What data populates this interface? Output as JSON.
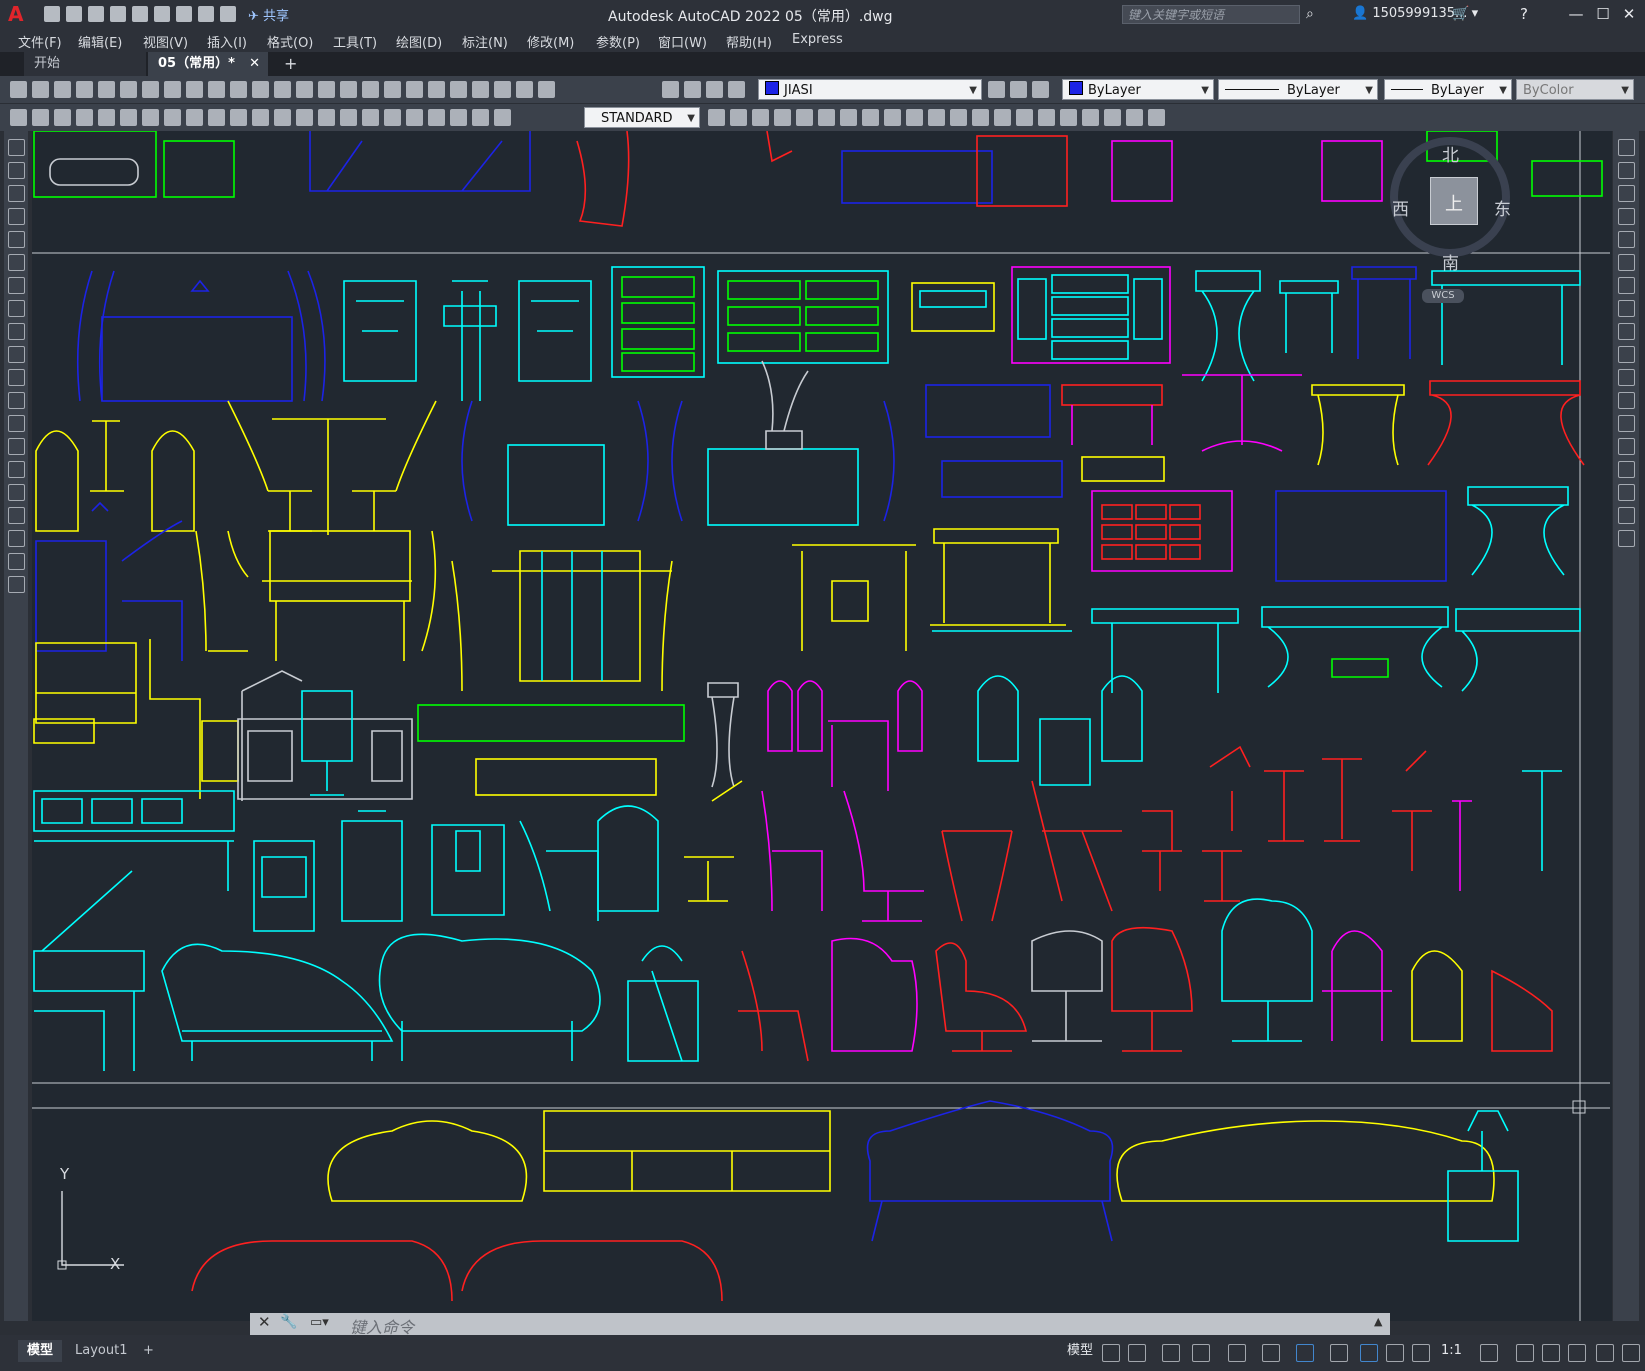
{
  "app": {
    "logo": "A",
    "share_label": "共享",
    "title": "Autodesk AutoCAD 2022    05（常用）.dwg",
    "search_placeholder": "键入关键字或短语",
    "user": "1505999135...",
    "win_min": "—",
    "win_max": "☐",
    "win_close": "✕"
  },
  "menu": [
    "文件(F)",
    "编辑(E)",
    "视图(V)",
    "插入(I)",
    "格式(O)",
    "工具(T)",
    "绘图(D)",
    "标注(N)",
    "修改(M)",
    "参数(P)",
    "窗口(W)",
    "帮助(H)",
    "Express"
  ],
  "tabs": [
    {
      "label": "开始",
      "active": false
    },
    {
      "label": "05（常用）*",
      "active": true
    }
  ],
  "tab_close": "✕",
  "tab_add": "+",
  "toolbar": {
    "layer": "JIASI",
    "color": "ByLayer",
    "linetype": "ByLayer",
    "lineweight": "ByLayer",
    "plotstyle": "ByColor",
    "textstyle": "STANDARD"
  },
  "viewcube": {
    "north": "北",
    "south": "南",
    "west": "西",
    "east": "东",
    "top": "上",
    "wcs": "WCS"
  },
  "ucs": {
    "x": "X",
    "y": "Y"
  },
  "command": {
    "placeholder": "键入命令"
  },
  "status": {
    "model_tab": "模型",
    "layout_tab": "Layout1",
    "add": "+",
    "mode": "模型",
    "scale": "1:1"
  },
  "colors": {
    "canvas": "#212830",
    "yellow": "#ffff00",
    "cyan": "#00ffff",
    "blue": "#1c23e6",
    "magenta": "#ff00ff",
    "red": "#ff2020",
    "green": "#00ff00"
  }
}
